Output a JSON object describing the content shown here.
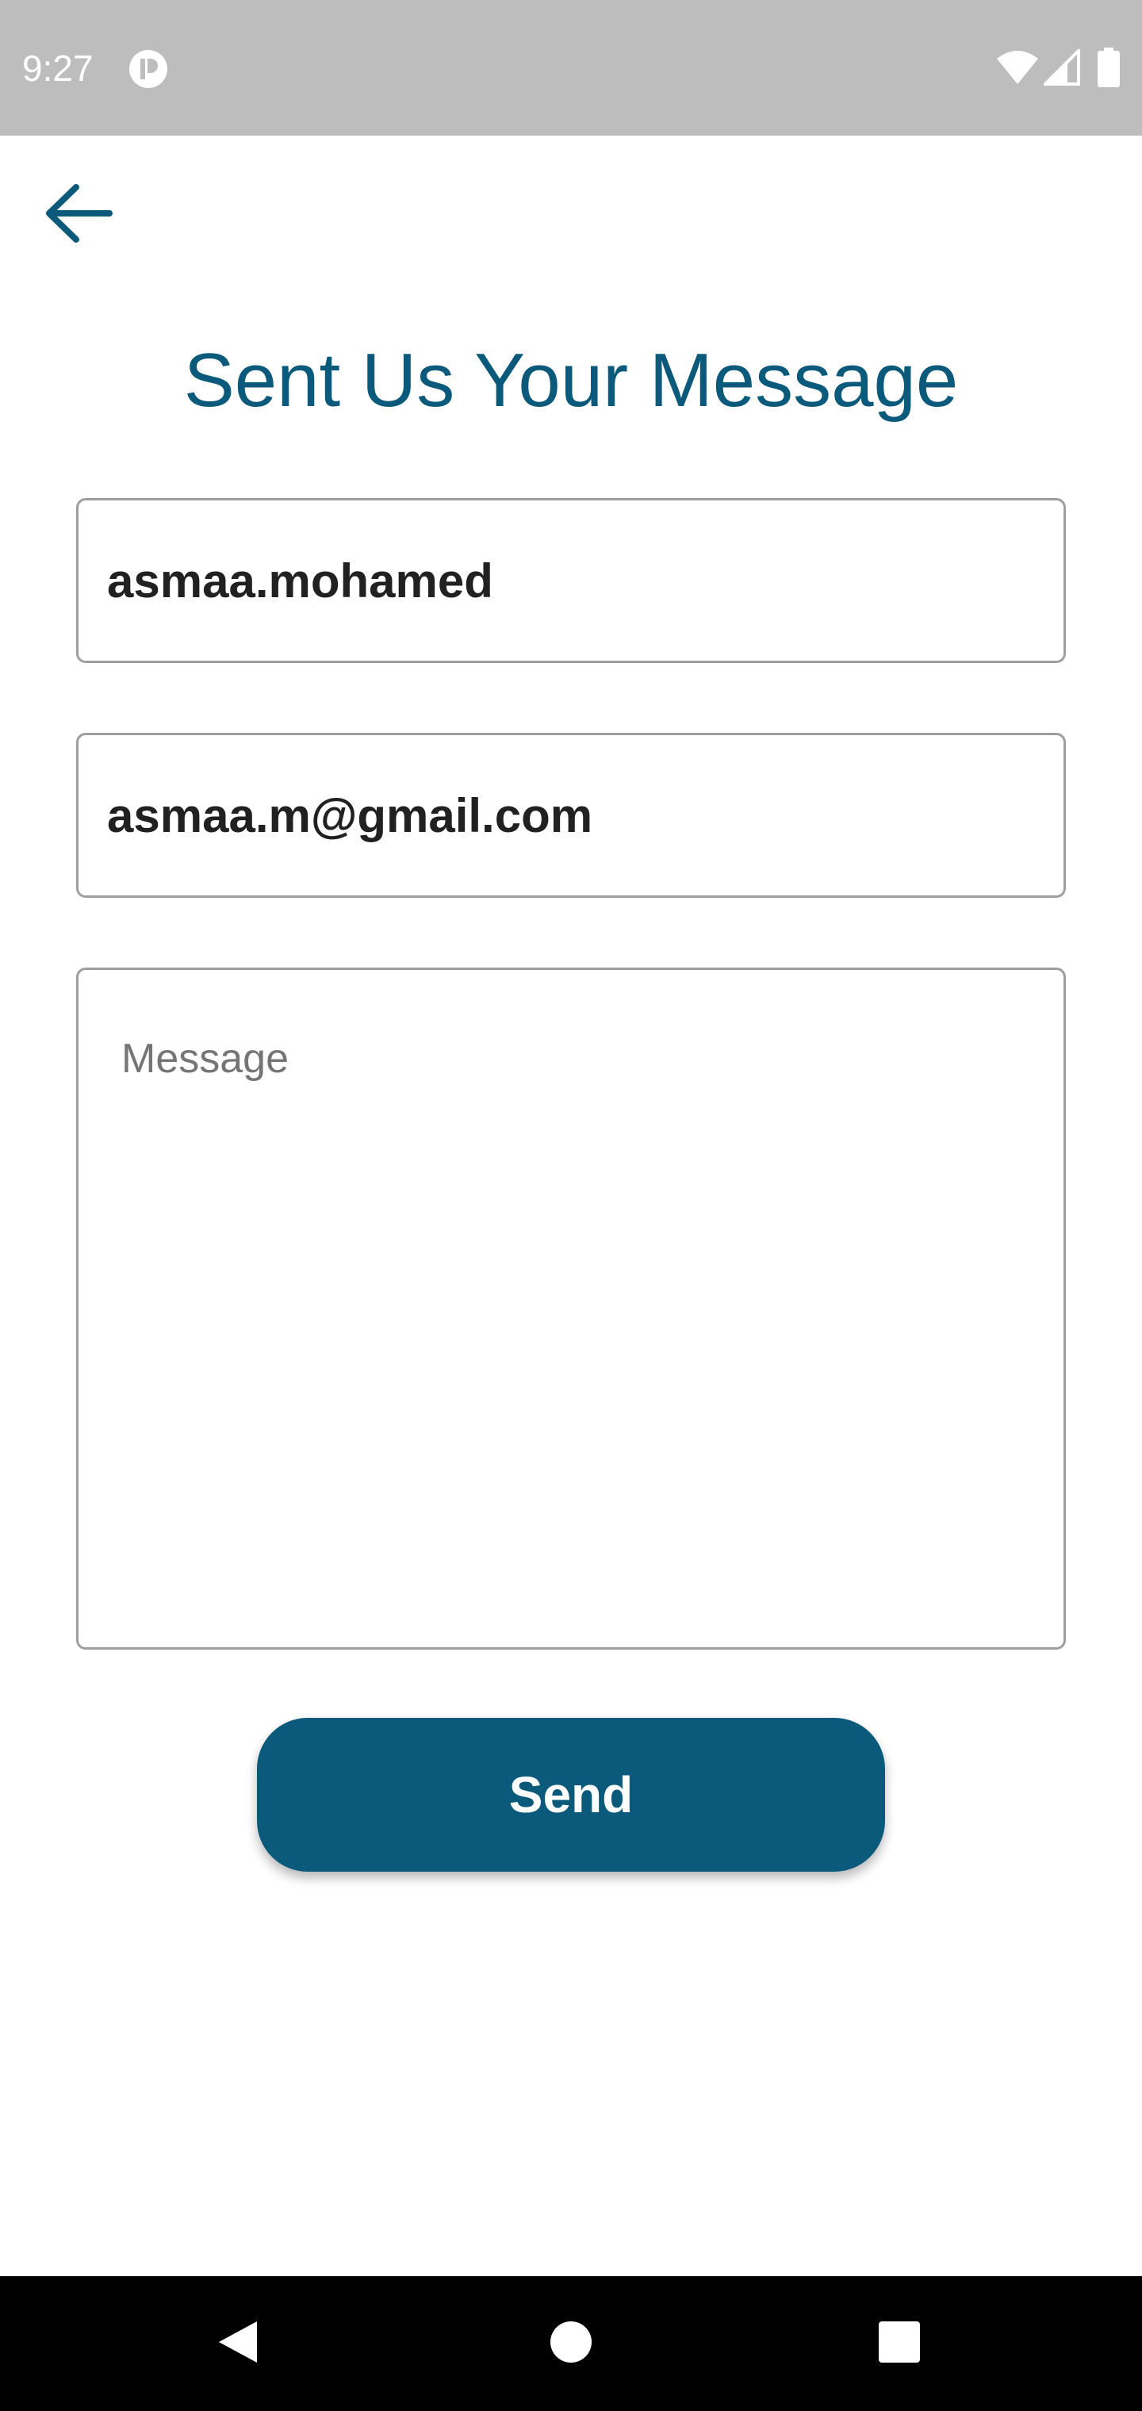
{
  "status_bar": {
    "time": "9:27",
    "app_icon": "app-notification-icon",
    "wifi_icon": "wifi-icon",
    "signal_icon": "signal-icon",
    "battery_icon": "battery-icon"
  },
  "header": {
    "back_icon": "arrow-back-icon",
    "title": "Sent Us Your Message"
  },
  "form": {
    "username_value": "asmaa.mohamed",
    "email_value": "asmaa.m@gmail.com",
    "message_value": "",
    "message_placeholder": "Message",
    "send_label": "Send"
  },
  "nav_bar": {
    "back_icon": "nav-back-icon",
    "home_icon": "nav-home-icon",
    "recents_icon": "nav-recents-icon"
  },
  "colors": {
    "accent": "#0b5a7b",
    "status_bar_bg": "#bdbdbd",
    "input_border": "#9e9e9e",
    "nav_bar_bg": "#000000"
  }
}
